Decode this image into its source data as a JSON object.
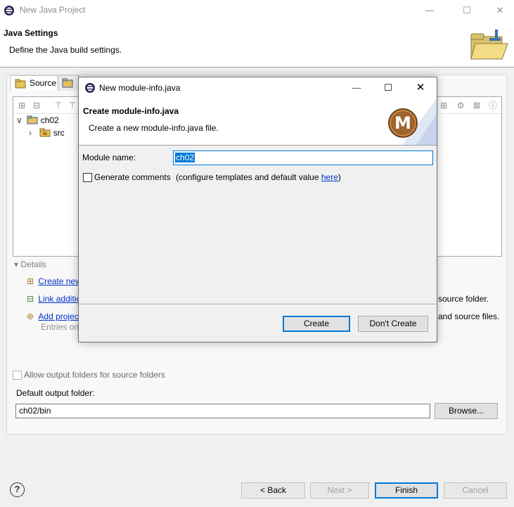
{
  "window": {
    "title": "New Java Project",
    "minimize": "—",
    "maximize": "☐",
    "close": "✕"
  },
  "header": {
    "title": "Java Settings",
    "description": "Define the Java build settings."
  },
  "tabs": [
    {
      "label": "Source"
    }
  ],
  "tree": [
    {
      "label": "ch02",
      "expander": "∨"
    },
    {
      "label": "src",
      "expander": "›"
    }
  ],
  "details": {
    "label": "Details",
    "toggle": "▾",
    "create_link": "Create new",
    "create_suffix": "source folder.",
    "link_additional": "Link additional",
    "add_project": "Add project",
    "add_suffix": "and source files.",
    "entries_note": "Entries on"
  },
  "options": {
    "allow_output_folders": "Allow output folders for source folders",
    "default_output_label": "Default output folder:",
    "default_output_value": "ch02/bin",
    "browse_button": "Browse..."
  },
  "footer": {
    "help": "?",
    "back": "< Back",
    "next": "Next >",
    "finish": "Finish",
    "cancel": "Cancel"
  },
  "dialog": {
    "title": "New module-info.java",
    "minimize": "—",
    "maximize": "☐",
    "close": "✕",
    "header_title": "Create module-info.java",
    "header_desc": "Create a new module-info.java file.",
    "logo_letter": "M",
    "module_name_label": "Module name:",
    "module_name_value": "ch02",
    "generate_comments_label": "Generate comments",
    "generate_comments_suffix_pre": "(configure templates and default value",
    "generate_comments_link": "here",
    "generate_comments_suffix_post": ")",
    "create_button": "Create",
    "dont_create_button": "Don't Create"
  },
  "colors": {
    "accent": "#0078d7",
    "link": "#0033cc",
    "logo_brown": "#a0622b"
  }
}
